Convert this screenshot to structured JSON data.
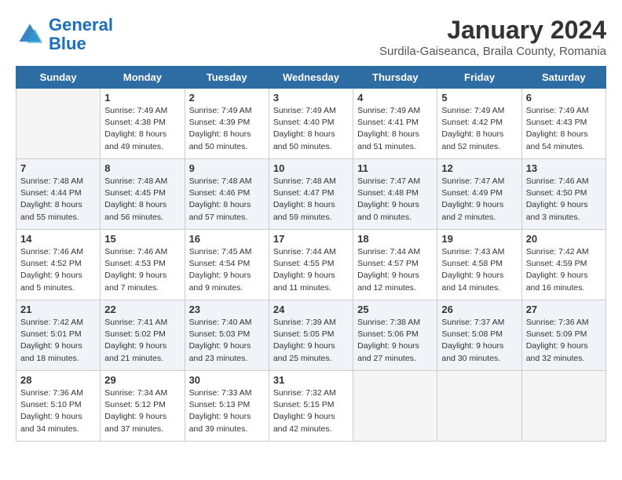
{
  "logo": {
    "line1": "General",
    "line2": "Blue"
  },
  "title": "January 2024",
  "subtitle": "Surdila-Gaiseanca, Braila County, Romania",
  "weekdays": [
    "Sunday",
    "Monday",
    "Tuesday",
    "Wednesday",
    "Thursday",
    "Friday",
    "Saturday"
  ],
  "weeks": [
    [
      {
        "day": "",
        "sunrise": "",
        "sunset": "",
        "daylight": ""
      },
      {
        "day": "1",
        "sunrise": "Sunrise: 7:49 AM",
        "sunset": "Sunset: 4:38 PM",
        "daylight": "Daylight: 8 hours and 49 minutes."
      },
      {
        "day": "2",
        "sunrise": "Sunrise: 7:49 AM",
        "sunset": "Sunset: 4:39 PM",
        "daylight": "Daylight: 8 hours and 50 minutes."
      },
      {
        "day": "3",
        "sunrise": "Sunrise: 7:49 AM",
        "sunset": "Sunset: 4:40 PM",
        "daylight": "Daylight: 8 hours and 50 minutes."
      },
      {
        "day": "4",
        "sunrise": "Sunrise: 7:49 AM",
        "sunset": "Sunset: 4:41 PM",
        "daylight": "Daylight: 8 hours and 51 minutes."
      },
      {
        "day": "5",
        "sunrise": "Sunrise: 7:49 AM",
        "sunset": "Sunset: 4:42 PM",
        "daylight": "Daylight: 8 hours and 52 minutes."
      },
      {
        "day": "6",
        "sunrise": "Sunrise: 7:49 AM",
        "sunset": "Sunset: 4:43 PM",
        "daylight": "Daylight: 8 hours and 54 minutes."
      }
    ],
    [
      {
        "day": "7",
        "sunrise": "Sunrise: 7:48 AM",
        "sunset": "Sunset: 4:44 PM",
        "daylight": "Daylight: 8 hours and 55 minutes."
      },
      {
        "day": "8",
        "sunrise": "Sunrise: 7:48 AM",
        "sunset": "Sunset: 4:45 PM",
        "daylight": "Daylight: 8 hours and 56 minutes."
      },
      {
        "day": "9",
        "sunrise": "Sunrise: 7:48 AM",
        "sunset": "Sunset: 4:46 PM",
        "daylight": "Daylight: 8 hours and 57 minutes."
      },
      {
        "day": "10",
        "sunrise": "Sunrise: 7:48 AM",
        "sunset": "Sunset: 4:47 PM",
        "daylight": "Daylight: 8 hours and 59 minutes."
      },
      {
        "day": "11",
        "sunrise": "Sunrise: 7:47 AM",
        "sunset": "Sunset: 4:48 PM",
        "daylight": "Daylight: 9 hours and 0 minutes."
      },
      {
        "day": "12",
        "sunrise": "Sunrise: 7:47 AM",
        "sunset": "Sunset: 4:49 PM",
        "daylight": "Daylight: 9 hours and 2 minutes."
      },
      {
        "day": "13",
        "sunrise": "Sunrise: 7:46 AM",
        "sunset": "Sunset: 4:50 PM",
        "daylight": "Daylight: 9 hours and 3 minutes."
      }
    ],
    [
      {
        "day": "14",
        "sunrise": "Sunrise: 7:46 AM",
        "sunset": "Sunset: 4:52 PM",
        "daylight": "Daylight: 9 hours and 5 minutes."
      },
      {
        "day": "15",
        "sunrise": "Sunrise: 7:46 AM",
        "sunset": "Sunset: 4:53 PM",
        "daylight": "Daylight: 9 hours and 7 minutes."
      },
      {
        "day": "16",
        "sunrise": "Sunrise: 7:45 AM",
        "sunset": "Sunset: 4:54 PM",
        "daylight": "Daylight: 9 hours and 9 minutes."
      },
      {
        "day": "17",
        "sunrise": "Sunrise: 7:44 AM",
        "sunset": "Sunset: 4:55 PM",
        "daylight": "Daylight: 9 hours and 11 minutes."
      },
      {
        "day": "18",
        "sunrise": "Sunrise: 7:44 AM",
        "sunset": "Sunset: 4:57 PM",
        "daylight": "Daylight: 9 hours and 12 minutes."
      },
      {
        "day": "19",
        "sunrise": "Sunrise: 7:43 AM",
        "sunset": "Sunset: 4:58 PM",
        "daylight": "Daylight: 9 hours and 14 minutes."
      },
      {
        "day": "20",
        "sunrise": "Sunrise: 7:42 AM",
        "sunset": "Sunset: 4:59 PM",
        "daylight": "Daylight: 9 hours and 16 minutes."
      }
    ],
    [
      {
        "day": "21",
        "sunrise": "Sunrise: 7:42 AM",
        "sunset": "Sunset: 5:01 PM",
        "daylight": "Daylight: 9 hours and 18 minutes."
      },
      {
        "day": "22",
        "sunrise": "Sunrise: 7:41 AM",
        "sunset": "Sunset: 5:02 PM",
        "daylight": "Daylight: 9 hours and 21 minutes."
      },
      {
        "day": "23",
        "sunrise": "Sunrise: 7:40 AM",
        "sunset": "Sunset: 5:03 PM",
        "daylight": "Daylight: 9 hours and 23 minutes."
      },
      {
        "day": "24",
        "sunrise": "Sunrise: 7:39 AM",
        "sunset": "Sunset: 5:05 PM",
        "daylight": "Daylight: 9 hours and 25 minutes."
      },
      {
        "day": "25",
        "sunrise": "Sunrise: 7:38 AM",
        "sunset": "Sunset: 5:06 PM",
        "daylight": "Daylight: 9 hours and 27 minutes."
      },
      {
        "day": "26",
        "sunrise": "Sunrise: 7:37 AM",
        "sunset": "Sunset: 5:08 PM",
        "daylight": "Daylight: 9 hours and 30 minutes."
      },
      {
        "day": "27",
        "sunrise": "Sunrise: 7:36 AM",
        "sunset": "Sunset: 5:09 PM",
        "daylight": "Daylight: 9 hours and 32 minutes."
      }
    ],
    [
      {
        "day": "28",
        "sunrise": "Sunrise: 7:36 AM",
        "sunset": "Sunset: 5:10 PM",
        "daylight": "Daylight: 9 hours and 34 minutes."
      },
      {
        "day": "29",
        "sunrise": "Sunrise: 7:34 AM",
        "sunset": "Sunset: 5:12 PM",
        "daylight": "Daylight: 9 hours and 37 minutes."
      },
      {
        "day": "30",
        "sunrise": "Sunrise: 7:33 AM",
        "sunset": "Sunset: 5:13 PM",
        "daylight": "Daylight: 9 hours and 39 minutes."
      },
      {
        "day": "31",
        "sunrise": "Sunrise: 7:32 AM",
        "sunset": "Sunset: 5:15 PM",
        "daylight": "Daylight: 9 hours and 42 minutes."
      },
      {
        "day": "",
        "sunrise": "",
        "sunset": "",
        "daylight": ""
      },
      {
        "day": "",
        "sunrise": "",
        "sunset": "",
        "daylight": ""
      },
      {
        "day": "",
        "sunrise": "",
        "sunset": "",
        "daylight": ""
      }
    ]
  ]
}
